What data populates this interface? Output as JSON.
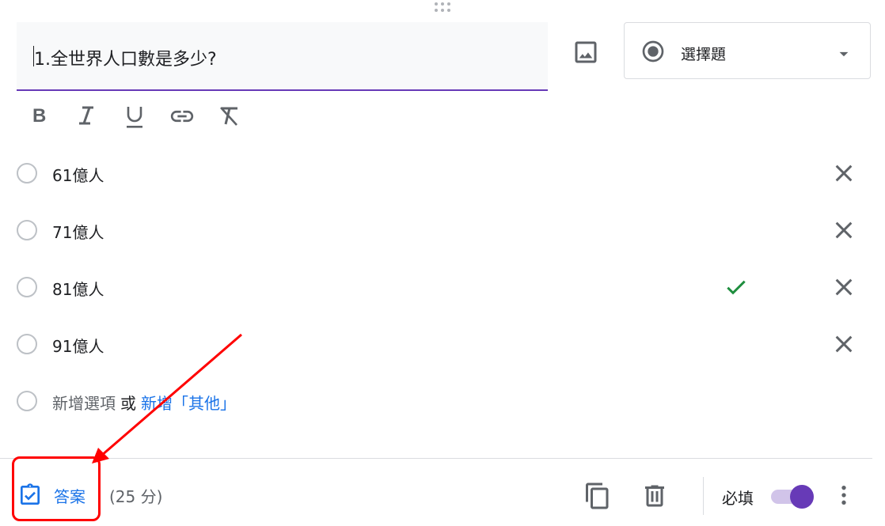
{
  "question": {
    "title": "1.全世界人口數是多少?",
    "type_label": "選擇題"
  },
  "options": [
    {
      "label": "61億人",
      "correct": false
    },
    {
      "label": "71億人",
      "correct": false
    },
    {
      "label": "81億人",
      "correct": true
    },
    {
      "label": "91億人",
      "correct": false
    }
  ],
  "add_option": {
    "placeholder": "新增選項",
    "or": "或",
    "other_link": "新增「其他」"
  },
  "footer": {
    "answer_key_label": "答案",
    "points": "(25 分)",
    "required_label": "必填",
    "required_on": true
  },
  "colors": {
    "accent": "#673ab7",
    "link": "#1a73e8",
    "correct": "#1e8e3e",
    "annotation": "#ff0000"
  },
  "icons": {
    "image": "image-icon",
    "radio": "radio-checked-icon",
    "dropdown": "arrow-drop-down-icon",
    "bold": "bold-icon",
    "italic": "italic-icon",
    "underline": "underline-icon",
    "link": "link-icon",
    "clear": "clear-format-icon",
    "remove": "close-icon",
    "check": "check-icon",
    "answer_key": "assignment-check-icon",
    "copy": "copy-icon",
    "delete": "trash-icon",
    "more": "more-vert-icon"
  }
}
